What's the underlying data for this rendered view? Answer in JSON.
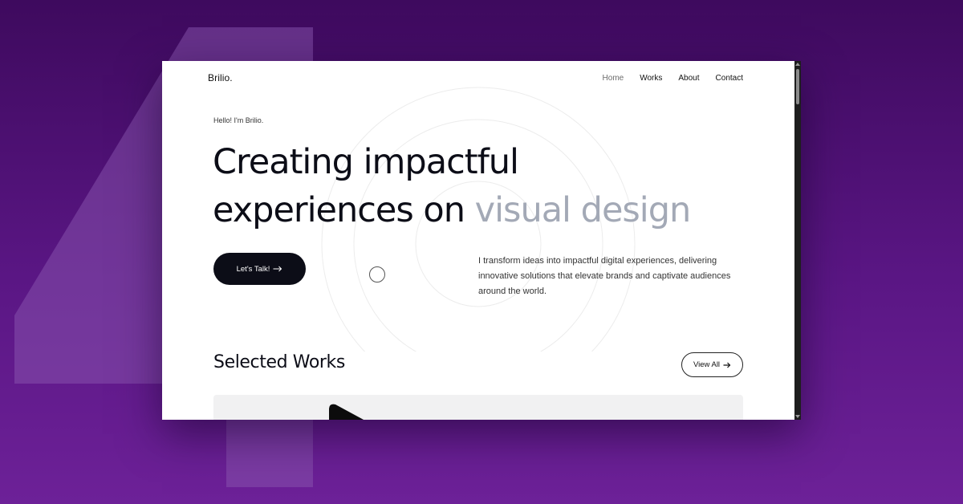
{
  "header": {
    "logo": "Brilio.",
    "nav": [
      {
        "label": "Home",
        "active": true
      },
      {
        "label": "Works",
        "active": false
      },
      {
        "label": "About",
        "active": false
      },
      {
        "label": "Contact",
        "active": false
      }
    ]
  },
  "hero": {
    "greeting": "Hello! I'm Brilio.",
    "headline_line1": "Creating impactful",
    "headline_line2_dark": "experiences on ",
    "headline_line2_muted": "visual design",
    "cta_label": "Let's Talk!",
    "cta_icon": "arrow-right-icon",
    "description": "I transform ideas into impactful digital experiences, delivering innovative solutions that elevate brands and captivate audiences around the world."
  },
  "works": {
    "title": "Selected Works",
    "view_all_label": "View All",
    "view_all_icon": "arrow-right-icon"
  },
  "colors": {
    "background_purple": "#5a1684",
    "text_dark": "#0c0d17",
    "text_muted": "#a3a9b6",
    "button_dark": "#0c0d17"
  }
}
